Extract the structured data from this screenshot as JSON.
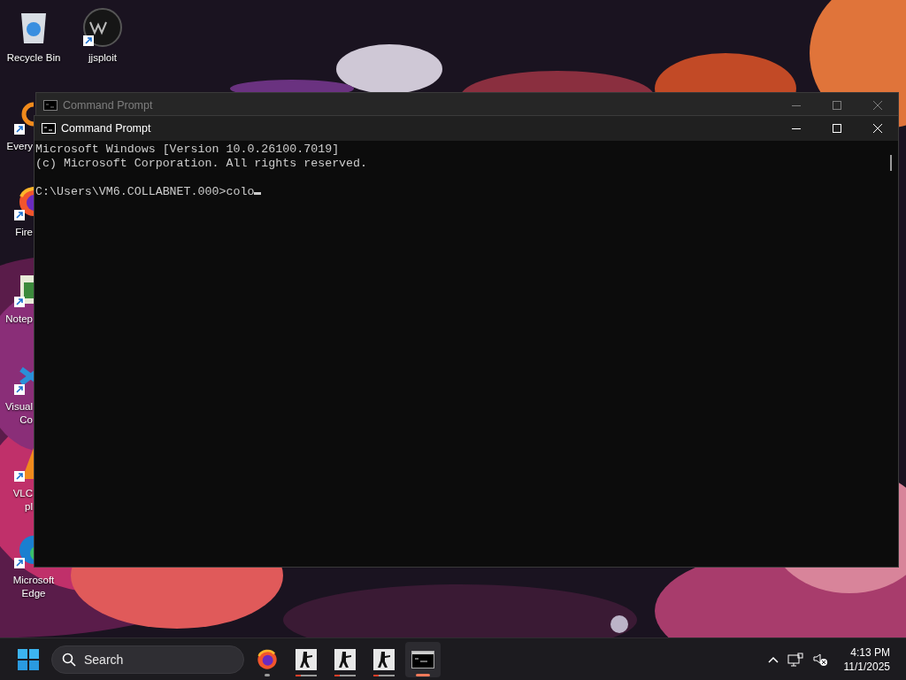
{
  "desktop_icons": [
    {
      "kind": "recycle",
      "lines": [
        "Recycle Bin"
      ],
      "shortcut": false
    },
    {
      "kind": "emblem",
      "lines": [
        "jjsploit"
      ],
      "shortcut": true
    },
    {
      "kind": "search-app",
      "lines": [
        "Every"
      ],
      "shortcut": true
    },
    {
      "kind": "firefox",
      "lines": [
        "Fire"
      ],
      "shortcut": true
    },
    {
      "kind": "notepad",
      "lines": [
        "Notep"
      ],
      "shortcut": true
    },
    {
      "kind": "vscode",
      "lines": [
        "Visual",
        "Co"
      ],
      "shortcut": true
    },
    {
      "kind": "vlc",
      "lines": [
        "VLC",
        "pl"
      ],
      "shortcut": true
    },
    {
      "kind": "edge",
      "lines": [
        "Microsoft",
        "Edge"
      ],
      "shortcut": true
    }
  ],
  "windows": [
    {
      "title": "Command Prompt",
      "active": false
    },
    {
      "title": "Command Prompt",
      "active": true,
      "lines": [
        "Microsoft Windows [Version 10.0.26100.7019]",
        "(c) Microsoft Corporation. All rights reserved."
      ],
      "prompt": "C:\\Users\\VM6.COLLABNET.000>colo"
    }
  ],
  "taskbar": {
    "search": {
      "placeholder": "Search"
    },
    "apps": [
      {
        "kind": "firefox",
        "active": false
      },
      {
        "kind": "soldier",
        "active": false,
        "level": 0.25
      },
      {
        "kind": "soldier",
        "active": false,
        "level": 0.25
      },
      {
        "kind": "soldier",
        "active": false,
        "level": 0.25
      },
      {
        "kind": "terminal",
        "active": true
      }
    ],
    "clock": {
      "time": "4:13 PM",
      "date": "11/1/2025"
    }
  }
}
